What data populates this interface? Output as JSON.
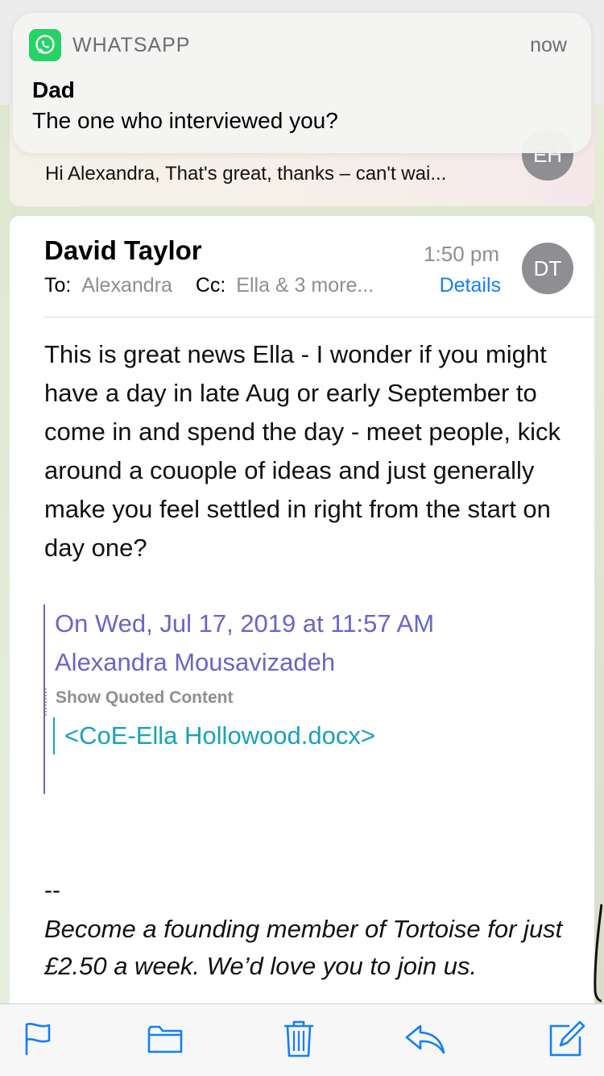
{
  "notification": {
    "app": "WHATSAPP",
    "time": "now",
    "sender": "Dad",
    "message": "The one who interviewed you?"
  },
  "previous_message": {
    "snippet": "Hi Alexandra, That's great, thanks – can't wai...",
    "avatar_initials": "EH"
  },
  "message": {
    "from": "David Taylor",
    "time": "1:50 pm",
    "avatar_initials": "DT",
    "to_label": "To:",
    "to_value": "Alexandra",
    "cc_label": "Cc:",
    "cc_value": "Ella & 3 more...",
    "details_link": "Details",
    "body": "This is great news Ella - I wonder if you might have a day in late Aug or early September to come in and spend the day - meet people, kick around a couople of ideas and just generally make you feel settled in right from the start on day one?",
    "quote_attribution_line1": "On Wed, Jul 17, 2019 at 11:57 AM",
    "quote_attribution_line2": "Alexandra Mousavizadeh",
    "show_quoted": "Show Quoted Content",
    "attachment": "<CoE-Ella Hollowood.docx>",
    "signature_dash": "--",
    "signature": "Become a founding member of Tortoise for just £2.50 a week. We’d love you to join us."
  },
  "toolbar": {
    "icons": [
      "flag-icon",
      "folder-icon",
      "trash-icon",
      "reply-icon",
      "compose-icon"
    ]
  },
  "colors": {
    "accent": "#147efb",
    "quote": "#6a64c8",
    "attachment": "#19a1b9",
    "whatsapp": "#25d366",
    "avatar": "#8e8e93"
  }
}
